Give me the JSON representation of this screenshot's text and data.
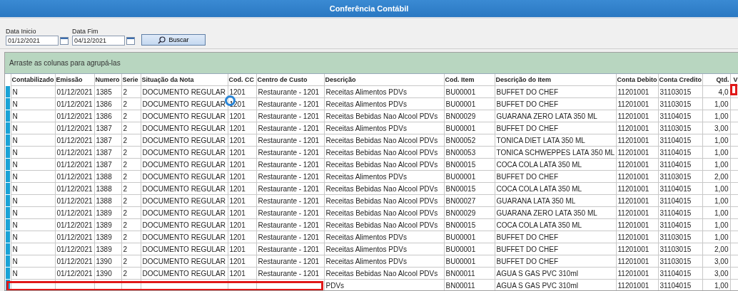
{
  "window": {
    "title": "Conferência Contábil"
  },
  "filters": {
    "start_label": "Data Inicio",
    "start_value": "01/12/2021",
    "end_label": "Data Fim",
    "end_value": "04/12/2021",
    "search_button": "Buscar"
  },
  "group_panel": {
    "hint": "Arraste as colunas para agrupá-las"
  },
  "table": {
    "columns": [
      "Contabilizado",
      "Emissão",
      "Numero",
      "Serie",
      "Situação da Nota",
      "Cod. CC",
      "Centro de Custo",
      "Descrição",
      "Cod. Item",
      "Descrição do Item",
      "Conta Debito",
      "Conta Credito",
      "Qtd.",
      "V"
    ],
    "rows": [
      [
        "N",
        "01/12/2021",
        "1385",
        "2",
        "DOCUMENTO REGULAR",
        "1201",
        "Restaurante - 1201",
        "Receitas Alimentos PDVs",
        "BU00001",
        "BUFFET DO CHEF",
        "11201001",
        "31103015",
        "4,0"
      ],
      [
        "N",
        "01/12/2021",
        "1386",
        "2",
        "DOCUMENTO REGULAR",
        "1201",
        "Restaurante - 1201",
        "Receitas Alimentos PDVs",
        "BU00001",
        "BUFFET DO CHEF",
        "11201001",
        "31103015",
        "1,00"
      ],
      [
        "N",
        "01/12/2021",
        "1386",
        "2",
        "DOCUMENTO REGULAR",
        "1201",
        "Restaurante - 1201",
        "Receitas Bebidas Nao Alcool PDVs",
        "BN00029",
        "GUARANA ZERO LATA 350 ML",
        "11201001",
        "31104015",
        "1,00"
      ],
      [
        "N",
        "01/12/2021",
        "1387",
        "2",
        "DOCUMENTO REGULAR",
        "1201",
        "Restaurante - 1201",
        "Receitas Alimentos PDVs",
        "BU00001",
        "BUFFET DO CHEF",
        "11201001",
        "31103015",
        "3,00"
      ],
      [
        "N",
        "01/12/2021",
        "1387",
        "2",
        "DOCUMENTO REGULAR",
        "1201",
        "Restaurante - 1201",
        "Receitas Bebidas Nao Alcool PDVs",
        "BN00052",
        "TONICA DIET LATA 350 ML",
        "11201001",
        "31104015",
        "1,00"
      ],
      [
        "N",
        "01/12/2021",
        "1387",
        "2",
        "DOCUMENTO REGULAR",
        "1201",
        "Restaurante - 1201",
        "Receitas Bebidas Nao Alcool PDVs",
        "BN00053",
        "TONICA SCHWEPPES LATA 350 ML",
        "11201001",
        "31104015",
        "1,00"
      ],
      [
        "N",
        "01/12/2021",
        "1387",
        "2",
        "DOCUMENTO REGULAR",
        "1201",
        "Restaurante - 1201",
        "Receitas Bebidas Nao Alcool PDVs",
        "BN00015",
        "COCA COLA LATA 350 ML",
        "11201001",
        "31104015",
        "1,00"
      ],
      [
        "N",
        "01/12/2021",
        "1388",
        "2",
        "DOCUMENTO REGULAR",
        "1201",
        "Restaurante - 1201",
        "Receitas Alimentos PDVs",
        "BU00001",
        "BUFFET DO CHEF",
        "11201001",
        "31103015",
        "2,00"
      ],
      [
        "N",
        "01/12/2021",
        "1388",
        "2",
        "DOCUMENTO REGULAR",
        "1201",
        "Restaurante - 1201",
        "Receitas Bebidas Nao Alcool PDVs",
        "BN00015",
        "COCA COLA LATA 350 ML",
        "11201001",
        "31104015",
        "1,00"
      ],
      [
        "N",
        "01/12/2021",
        "1388",
        "2",
        "DOCUMENTO REGULAR",
        "1201",
        "Restaurante - 1201",
        "Receitas Bebidas Nao Alcool PDVs",
        "BN00027",
        "GUARANA LATA 350 ML",
        "11201001",
        "31104015",
        "1,00"
      ],
      [
        "N",
        "01/12/2021",
        "1389",
        "2",
        "DOCUMENTO REGULAR",
        "1201",
        "Restaurante - 1201",
        "Receitas Bebidas Nao Alcool PDVs",
        "BN00029",
        "GUARANA ZERO LATA 350 ML",
        "11201001",
        "31104015",
        "1,00"
      ],
      [
        "N",
        "01/12/2021",
        "1389",
        "2",
        "DOCUMENTO REGULAR",
        "1201",
        "Restaurante - 1201",
        "Receitas Bebidas Nao Alcool PDVs",
        "BN00015",
        "COCA COLA LATA 350 ML",
        "11201001",
        "31104015",
        "1,00"
      ],
      [
        "N",
        "01/12/2021",
        "1389",
        "2",
        "DOCUMENTO REGULAR",
        "1201",
        "Restaurante - 1201",
        "Receitas Alimentos PDVs",
        "BU00001",
        "BUFFET DO CHEF",
        "11201001",
        "31103015",
        "1,00"
      ],
      [
        "N",
        "01/12/2021",
        "1389",
        "2",
        "DOCUMENTO REGULAR",
        "1201",
        "Restaurante - 1201",
        "Receitas Alimentos PDVs",
        "BU00001",
        "BUFFET DO CHEF",
        "11201001",
        "31103015",
        "2,00"
      ],
      [
        "N",
        "01/12/2021",
        "1390",
        "2",
        "DOCUMENTO REGULAR",
        "1201",
        "Restaurante - 1201",
        "Receitas Alimentos PDVs",
        "BU00001",
        "BUFFET DO CHEF",
        "11201001",
        "31103015",
        "3,00"
      ],
      [
        "N",
        "01/12/2021",
        "1390",
        "2",
        "DOCUMENTO REGULAR",
        "1201",
        "Restaurante - 1201",
        "Receitas Bebidas Nao Alcool PDVs",
        "BN00011",
        "AGUA S GAS PVC 310ml",
        "11201001",
        "31104015",
        "3,00"
      ],
      [
        null,
        null,
        null,
        null,
        null,
        null,
        null,
        "PDVs",
        "BN00011",
        "AGUA S GAS PVC 310ml",
        "11201001",
        "31104015",
        "1,00"
      ]
    ]
  }
}
